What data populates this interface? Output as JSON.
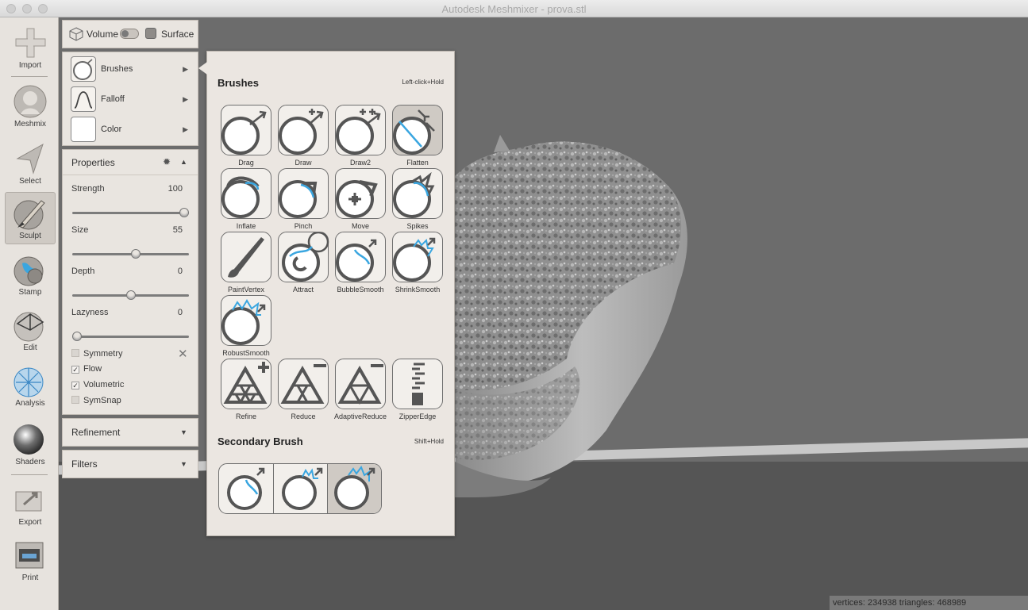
{
  "window": {
    "title": "Autodesk Meshmixer - prova.stl"
  },
  "toolbar": {
    "items": [
      {
        "label": "Import",
        "icon": "plus-icon"
      },
      {
        "label": "Meshmix",
        "icon": "meshmix-bust-icon"
      },
      {
        "label": "Select",
        "icon": "select-arrow-icon"
      },
      {
        "label": "Sculpt",
        "icon": "sculpt-brush-icon"
      },
      {
        "label": "Stamp",
        "icon": "stamp-icon"
      },
      {
        "label": "Edit",
        "icon": "edit-icon"
      },
      {
        "label": "Analysis",
        "icon": "analysis-icon"
      },
      {
        "label": "Shaders",
        "icon": "shaders-sphere-icon"
      },
      {
        "label": "Export",
        "icon": "export-icon"
      },
      {
        "label": "Print",
        "icon": "printer-icon"
      }
    ],
    "active": "Sculpt"
  },
  "mode": {
    "volume_label": "Volume",
    "surface_label": "Surface"
  },
  "brush_menu": {
    "items": [
      {
        "label": "Brushes"
      },
      {
        "label": "Falloff"
      },
      {
        "label": "Color"
      }
    ]
  },
  "properties": {
    "title": "Properties",
    "sliders": [
      {
        "label": "Strength",
        "value": "100",
        "fraction": 1.0
      },
      {
        "label": "Size",
        "value": "55",
        "fraction": 0.55
      },
      {
        "label": "Depth",
        "value": "0",
        "fraction": 0.5
      },
      {
        "label": "Lazyness",
        "value": "0",
        "fraction": 0.0
      }
    ],
    "checkboxes": [
      {
        "label": "Symmetry",
        "checked": false
      },
      {
        "label": "Flow",
        "checked": true
      },
      {
        "label": "Volumetric",
        "checked": true
      },
      {
        "label": "SymSnap",
        "checked": false
      }
    ]
  },
  "collapsed_panels": {
    "refinement": "Refinement",
    "filters": "Filters"
  },
  "brushes_popup": {
    "title": "Brushes",
    "hint": "Left-click+Hold",
    "brushes": [
      "Drag",
      "Draw",
      "Draw2",
      "Flatten",
      "Inflate",
      "Pinch",
      "Move",
      "Spikes",
      "PaintVertex",
      "Attract",
      "BubbleSmooth",
      "ShrinkSmooth",
      "RobustSmooth"
    ],
    "selected": "Flatten",
    "refine_tools": [
      "Refine",
      "Reduce",
      "AdaptiveReduce",
      "ZipperEdge"
    ],
    "secondary_title": "Secondary Brush",
    "secondary_hint": "Shift+Hold",
    "secondary_selected_index": 2
  },
  "status": {
    "text": "vertices: 234938 triangles: 468989"
  },
  "colors": {
    "accent_blue": "#3aa6e0",
    "panel_bg": "#e9e5e0",
    "viewport_bg": "#6c6c6c"
  }
}
